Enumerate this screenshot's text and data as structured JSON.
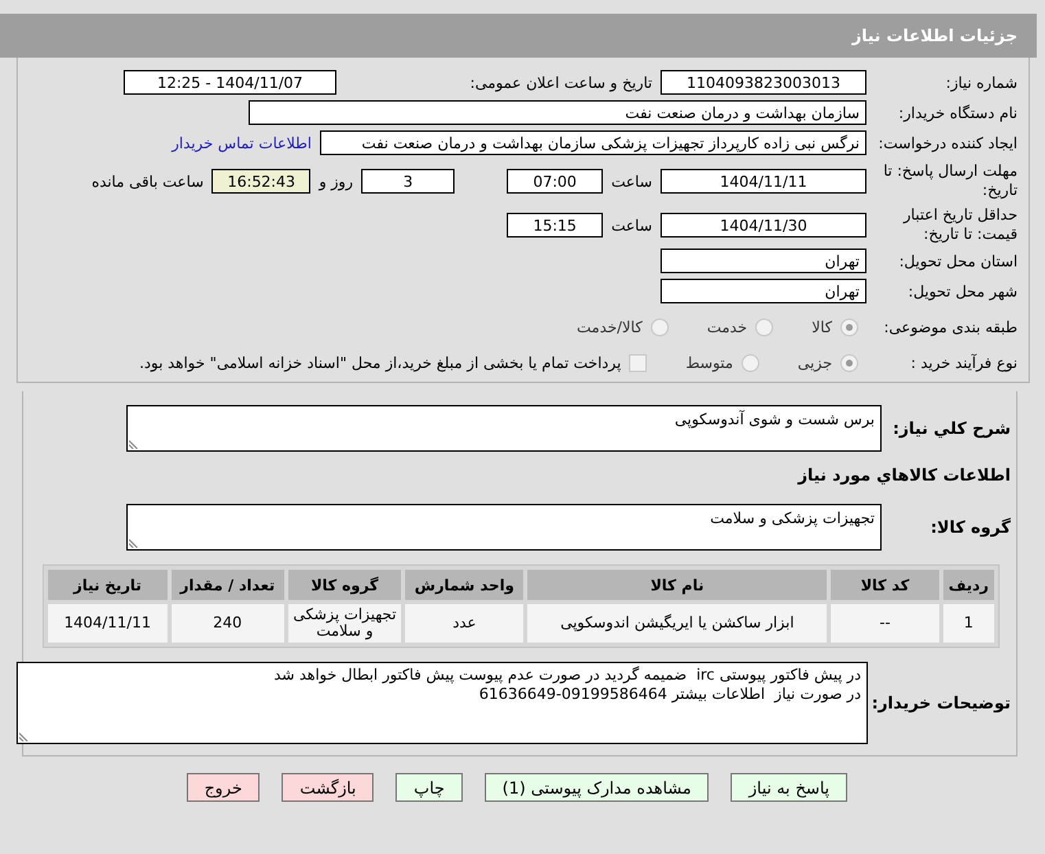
{
  "page_title": "جزئیات اطلاعات نیاز",
  "need_number": {
    "label": "شماره نیاز:",
    "value": "1104093823003013"
  },
  "announce": {
    "label": "تاریخ و ساعت اعلان عمومی:",
    "value": "1404/11/07 - 12:25"
  },
  "buyer_org": {
    "label": "نام دستگاه خریدار:",
    "value": "سازمان بهداشت و درمان صنعت نفت"
  },
  "requester": {
    "label": "ایجاد کننده درخواست:",
    "value": "نرگس نبی زاده کارپرداز تجهیزات پزشکی سازمان بهداشت و درمان صنعت نفت",
    "contact_link": "اطلاعات تماس خریدار"
  },
  "response_deadline": {
    "label": "مهلت ارسال پاسخ: تا تاریخ:",
    "date": "1404/11/11",
    "time_label": "ساعت",
    "time": "07:00",
    "days": "3",
    "days_label": "روز و",
    "remaining": "16:52:43",
    "remaining_label": "ساعت باقی مانده"
  },
  "price_validity": {
    "label": "حداقل تاریخ اعتبار قیمت: تا تاریخ:",
    "date": "1404/11/30",
    "time_label": "ساعت",
    "time": "15:15"
  },
  "province": {
    "label": "استان محل تحویل:",
    "value": "تهران"
  },
  "city": {
    "label": "شهر محل تحویل:",
    "value": "تهران"
  },
  "category": {
    "label": "طبقه بندی موضوعی:",
    "options": [
      {
        "label": "کالا",
        "selected": true
      },
      {
        "label": "خدمت",
        "selected": false
      },
      {
        "label": "کالا/خدمت",
        "selected": false
      }
    ]
  },
  "process": {
    "label": "نوع فرآیند خرید :",
    "options": [
      {
        "label": "جزیی",
        "selected": true
      },
      {
        "label": "متوسط",
        "selected": false
      }
    ],
    "payment": {
      "label": "پرداخت تمام یا بخشی از مبلغ خرید،از محل \"اسناد خزانه اسلامی\" خواهد بود.",
      "checked": false
    }
  },
  "description": {
    "label": "شرح کلي نياز:",
    "value": "برس شست و شوی آندوسکوپی"
  },
  "goods_title": "اطلاعات کالاهاي مورد نياز",
  "goods_group": {
    "label": "گروه کالا:",
    "value": "تجهیزات پزشکی و سلامت"
  },
  "table": {
    "columns": [
      "ردیف",
      "کد کالا",
      "نام کالا",
      "واحد شمارش",
      "گروه کالا",
      "تعداد / مقدار",
      "تاریخ نیاز"
    ],
    "rows": [
      [
        "1",
        "--",
        "ابزار ساکشن یا ایریگیشن اندوسکوپی",
        "عدد",
        "تجهیزات پزشکی و سلامت",
        "240",
        "1404/11/11"
      ]
    ]
  },
  "buyer_notes": {
    "label": "توضیحات خریدار:",
    "value": "در پیش فاکتور پیوستی irc  ضمیمه گردید در صورت عدم پیوست پیش فاکتور ابطال خواهد شد\nدر صورت نیاز  اطلاعات بیشتر 09199586464-61636649"
  },
  "buttons": [
    {
      "label": "پاسخ به نیاز",
      "kind": "action"
    },
    {
      "label": "مشاهده مدارک پیوستی (1)",
      "kind": "action"
    },
    {
      "label": "چاپ",
      "kind": "action"
    },
    {
      "label": "بازگشت",
      "kind": "exit"
    },
    {
      "label": "خروج",
      "kind": "exit"
    }
  ]
}
